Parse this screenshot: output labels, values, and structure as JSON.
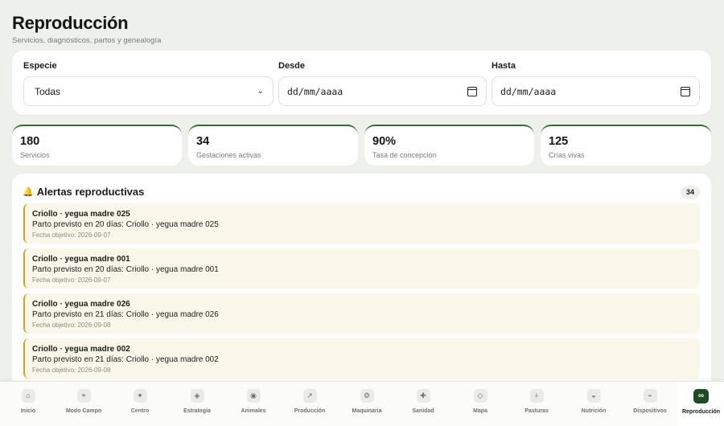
{
  "header": {
    "title": "Reproducción",
    "subtitle": "Servicios, diagnósticos, partos y genealogía"
  },
  "filters": {
    "especie": {
      "label": "Especie",
      "value": "Todas"
    },
    "desde": {
      "label": "Desde",
      "value": "dd/mm/aaaa"
    },
    "hasta": {
      "label": "Hasta",
      "value": "dd/mm/aaaa"
    }
  },
  "stats": [
    {
      "value": "180",
      "label": "Servicios"
    },
    {
      "value": "34",
      "label": "Gestaciones activas"
    },
    {
      "value": "90%",
      "label": "Tasa de concepción"
    },
    {
      "value": "125",
      "label": "Crías vivas"
    }
  ],
  "alerts": {
    "title": "Alertas reproductivas",
    "count": "34",
    "items": [
      {
        "title": "Criollo · yegua madre 025",
        "desc": "Parto previsto en 20 días: Criollo · yegua madre 025",
        "date": "Fecha objetivo: 2026-09-07"
      },
      {
        "title": "Criollo · yegua madre 001",
        "desc": "Parto previsto en 20 días: Criollo · yegua madre 001",
        "date": "Fecha objetivo: 2026-09-07"
      },
      {
        "title": "Criollo · yegua madre 026",
        "desc": "Parto previsto en 21 días: Criollo · yegua madre 026",
        "date": "Fecha objetivo: 2026-09-08"
      },
      {
        "title": "Criollo · yegua madre 002",
        "desc": "Parto previsto en 21 días: Criollo · yegua madre 002",
        "date": "Fecha objetivo: 2026-09-08"
      }
    ]
  },
  "nav": [
    {
      "label": "Inicio",
      "icon": "home-icon",
      "glyph": "⌂"
    },
    {
      "label": "Modo Campo",
      "icon": "crosshair-icon",
      "glyph": "⌖"
    },
    {
      "label": "Centro",
      "icon": "sparkle-icon",
      "glyph": "✦"
    },
    {
      "label": "Estrategia",
      "icon": "diamond-icon",
      "glyph": "◈"
    },
    {
      "label": "Animales",
      "icon": "target-icon",
      "glyph": "◉"
    },
    {
      "label": "Producción",
      "icon": "arrow-up-right-icon",
      "glyph": "↗"
    },
    {
      "label": "Maquinaria",
      "icon": "gear-icon",
      "glyph": "⚙"
    },
    {
      "label": "Sanidad",
      "icon": "plus-icon",
      "glyph": "✚"
    },
    {
      "label": "Mapa",
      "icon": "map-diamond-icon",
      "glyph": "◇"
    },
    {
      "label": "Pasturas",
      "icon": "grass-icon",
      "glyph": "⍭"
    },
    {
      "label": "Nutrición",
      "icon": "bowl-icon",
      "glyph": "◒"
    },
    {
      "label": "Dispositivos",
      "icon": "signal-icon",
      "glyph": "⌁"
    },
    {
      "label": "Reproducción",
      "icon": "infinity-icon",
      "glyph": "∞"
    }
  ],
  "colors": {
    "accent": "#2f6b35",
    "alert": "#d8a11c",
    "nav_active": "#1e4a24"
  }
}
